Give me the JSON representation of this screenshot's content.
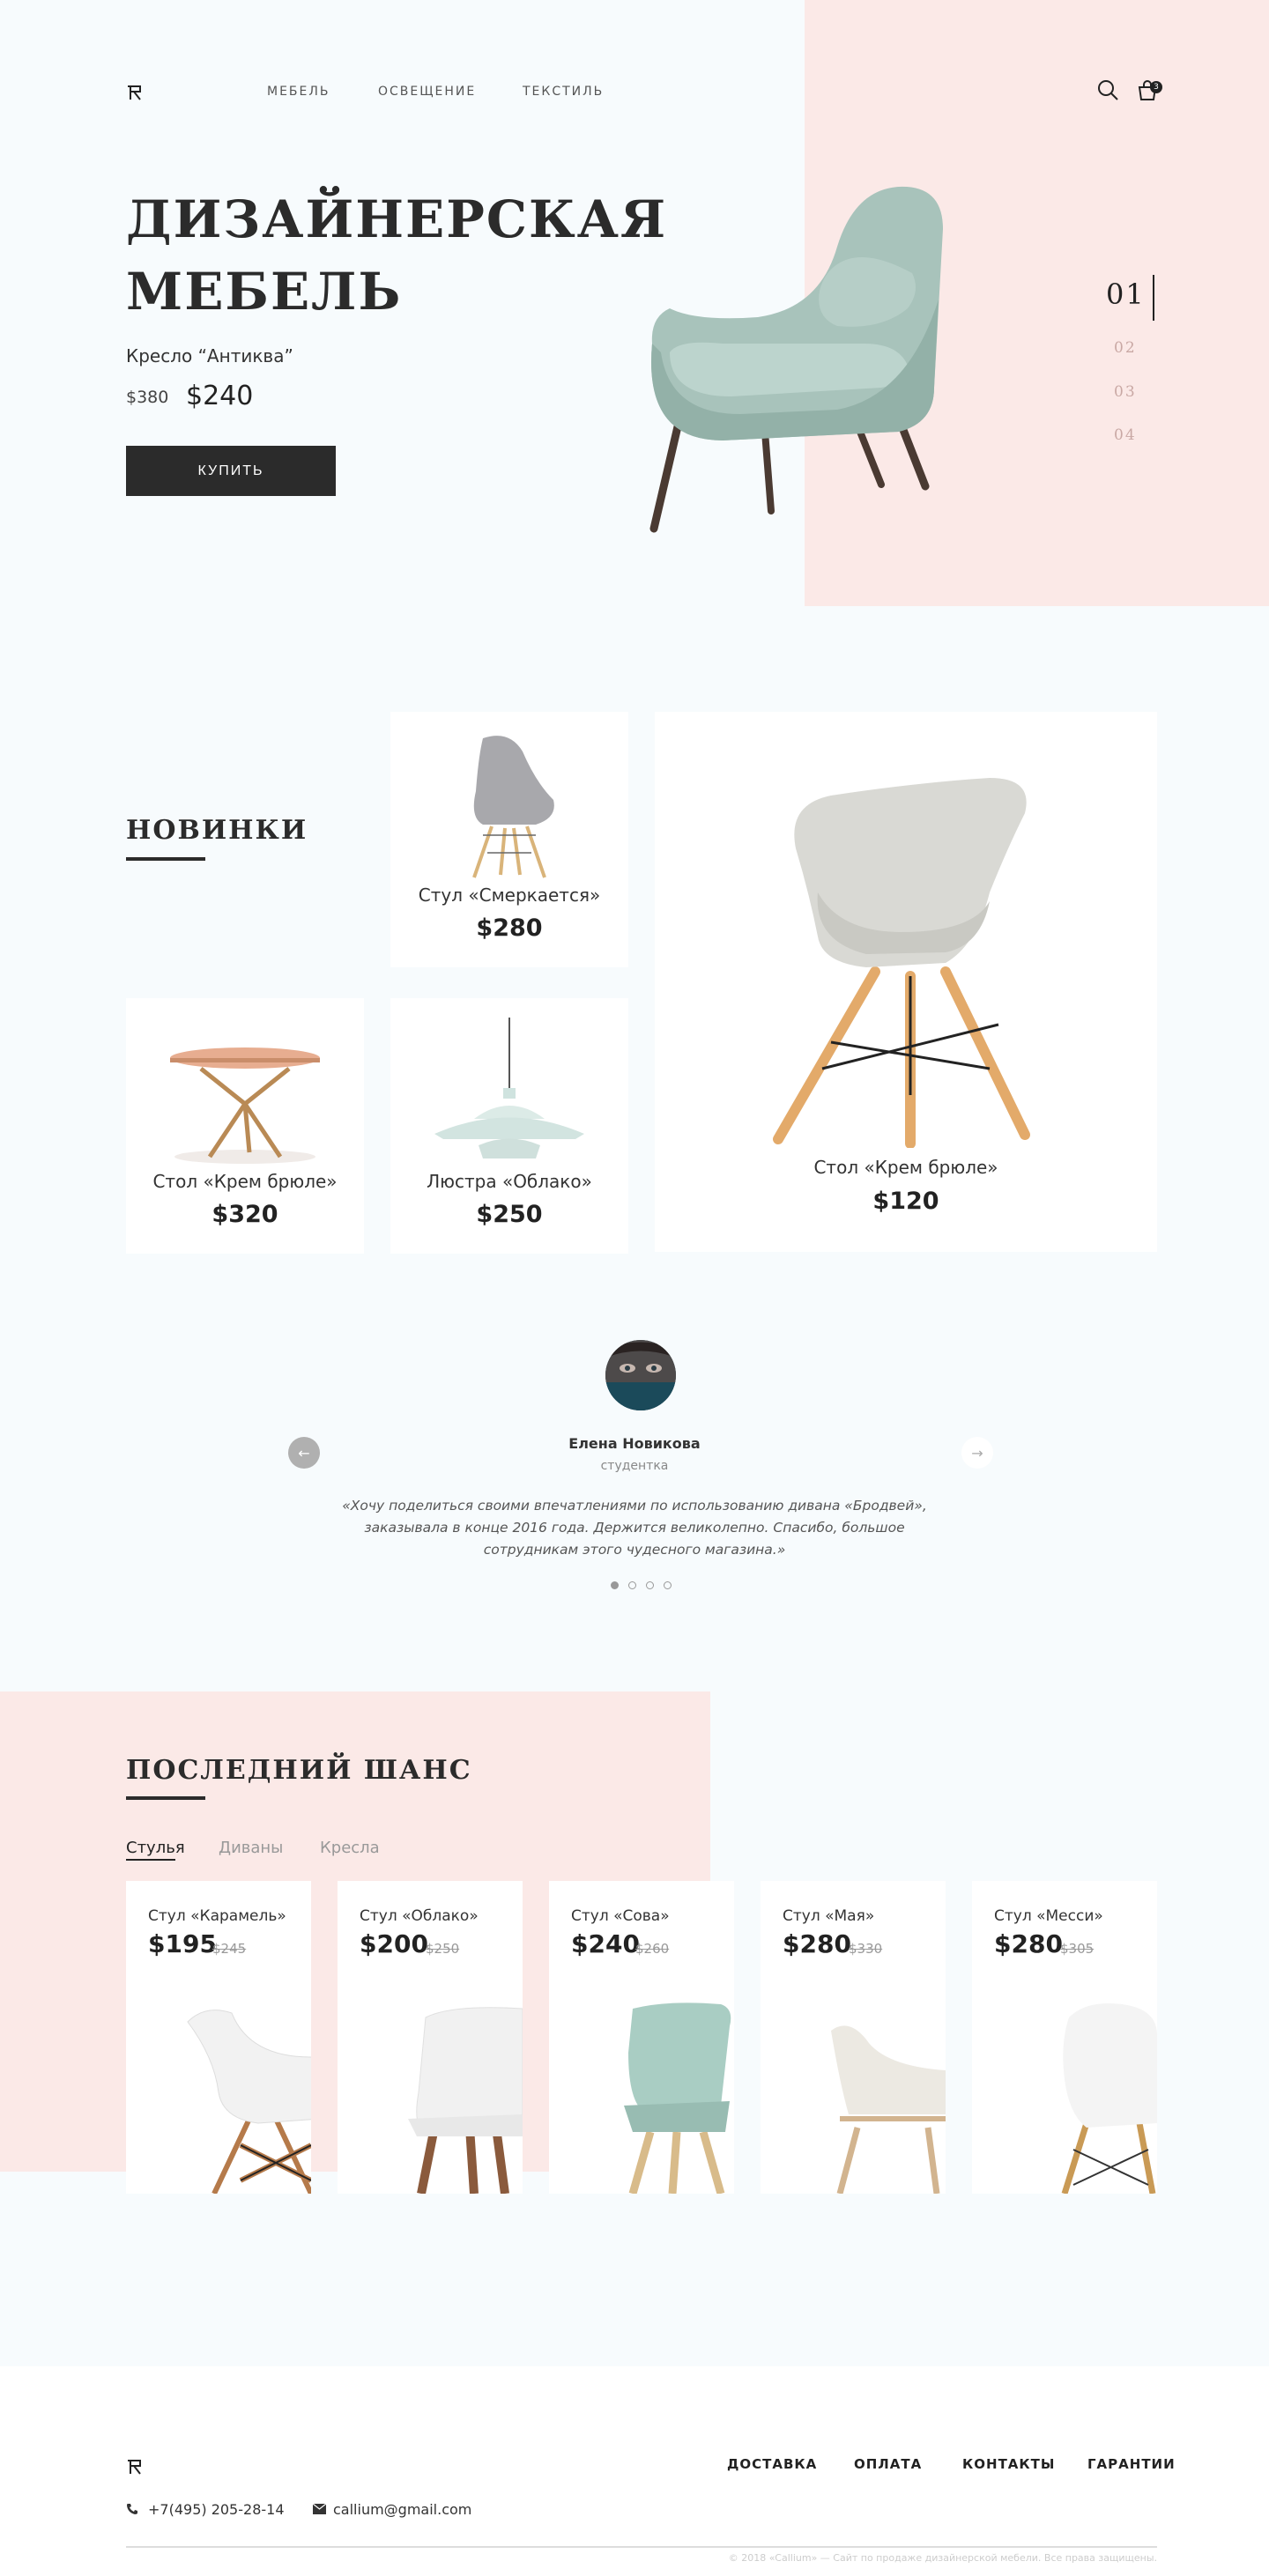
{
  "nav": {
    "items": [
      "МЕБЕЛЬ",
      "ОСВЕЩЕНИЕ",
      "ТЕКСТИЛЬ"
    ],
    "cart_count": "3"
  },
  "hero": {
    "title_line1": "ДИЗАЙНЕРСКАЯ",
    "title_line2": "МЕБЕЛЬ",
    "product": "Кресло “Антиква”",
    "old_price": "$380",
    "new_price": "$240",
    "button": "КУПИТЬ",
    "slides": [
      "01",
      "02",
      "03",
      "04"
    ]
  },
  "new_items": {
    "title": "НОВИНКИ",
    "cards": [
      {
        "name": "Стул «Смеркается»",
        "price": "$280"
      },
      {
        "name": "Стол «Крем брюле»",
        "price": "$120"
      },
      {
        "name": "Стол «Крем брюле»",
        "price": "$320"
      },
      {
        "name": "Люстра «Облако»",
        "price": "$250"
      }
    ]
  },
  "testimonial": {
    "name": "Елена Новикова",
    "role": "студентка",
    "quote_line1": "«Хочу поделиться своими впечатлениями по использованию дивана «Бродвей»,",
    "quote_line2": "заказывала в конце 2016 года. Держится великолепно. Спасибо, большое",
    "quote_line3": "сотрудникам этого чудесного магазина.»",
    "prev_arrow": "←",
    "next_arrow": "→"
  },
  "last_chance": {
    "title": "ПОСЛЕДНИЙ ШАНС",
    "tabs": [
      "Стулья",
      "Диваны",
      "Кресла"
    ],
    "products": [
      {
        "name": "Стул «Карамель»",
        "price": "$195",
        "old": "$245"
      },
      {
        "name": "Стул «Облако»",
        "price": "$200",
        "old": "$250"
      },
      {
        "name": "Стул «Сова»",
        "price": "$240",
        "old": "$260"
      },
      {
        "name": "Стул «Мая»",
        "price": "$280",
        "old": "$330"
      },
      {
        "name": "Стул «Месси»",
        "price": "$280",
        "old": "$305"
      }
    ]
  },
  "footer": {
    "nav": [
      "ДОСТАВКА",
      "ОПЛАТА",
      "КОНТАКТЫ",
      "ГАРАНТИИ"
    ],
    "phone": "+7(495) 205-28-14",
    "email": "callium@gmail.com",
    "copyright": "© 2018 «Callium» — Сайт по продаже дизайнерской мебели. Все права защищены."
  }
}
